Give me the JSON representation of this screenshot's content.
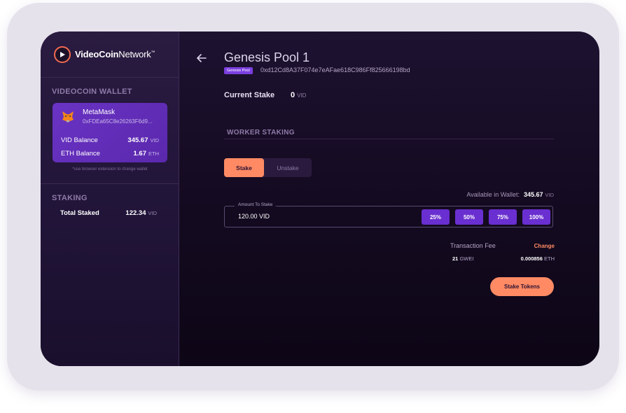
{
  "brand": {
    "name_bold": "VideoCoin",
    "name_light": "Network",
    "tm": "™",
    "accent": "#f26a4f"
  },
  "sidebar": {
    "wallet_title": "VIDEOCOIN WALLET",
    "wallet": {
      "provider": "MetaMask",
      "address": "0xFDEa65C8e26263F6d9...",
      "vid_label": "VID Balance",
      "vid_value": "345.67",
      "vid_unit": "VID",
      "eth_label": "ETH Balance",
      "eth_value": "1.67",
      "eth_unit": "ETH",
      "icon": "metamask-fox-icon"
    },
    "hint": "*use browser extension to change wallet",
    "staking_title": "STAKING",
    "total_staked_label": "Total Staked",
    "total_staked_value": "122.34",
    "total_staked_unit": "VID"
  },
  "main": {
    "back_icon": "arrow-left-icon",
    "pool_title": "Genesis Pool 1",
    "pool_badge": "Genesis Pool",
    "pool_address": "0xd12Cd8A37F074e7eAFae618C986Ff825666198bd",
    "current_stake_label": "Current Stake",
    "current_stake_value": "0",
    "current_stake_unit": "VID",
    "worker_staking_title": "WORKER STAKING",
    "tabs": [
      {
        "label": "Stake",
        "active": true
      },
      {
        "label": "Unstake",
        "active": false
      }
    ],
    "available_label": "Available in Wallet:",
    "available_value": "345.67",
    "available_unit": "VID",
    "amount_legend": "Amount To Stake",
    "amount_value": "120.00 VID",
    "percent_buttons": [
      "25%",
      "50%",
      "75%",
      "100%"
    ],
    "fee_label": "Transaction Fee",
    "fee_change": "Change",
    "gwei_value": "21",
    "gwei_unit": "GWEI",
    "eth_fee_value": "0.000856",
    "eth_fee_unit": "ETH",
    "stake_button": "Stake Tokens"
  },
  "colors": {
    "primary": "#6a2fd0",
    "accent": "#ff8a64",
    "background": "#150b22"
  }
}
